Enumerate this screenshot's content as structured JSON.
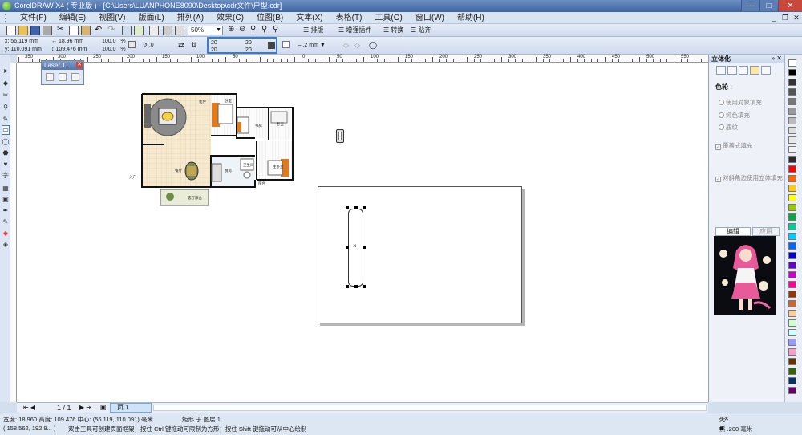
{
  "app": {
    "title": "CorelDRAW X4 ( 专业版 ) - [C:\\Users\\LUANPHONE8090\\Desktop\\cdr文件\\户型.cdr]"
  },
  "menu": [
    "文件(F)",
    "编辑(E)",
    "视图(V)",
    "版面(L)",
    "排列(A)",
    "效果(C)",
    "位图(B)",
    "文本(X)",
    "表格(T)",
    "工具(O)",
    "窗口(W)",
    "帮助(H)"
  ],
  "toolbar": {
    "zoom": "50%",
    "plugins": [
      "排版",
      "增强插件",
      "转换",
      "贴齐"
    ]
  },
  "properties": {
    "x": "56.119 mm",
    "y": "110.091 mm",
    "width": "18.96 mm",
    "height": "109.476 mm",
    "scale_x": "100.0",
    "scale_y": "100.0",
    "scale_unit": "%",
    "rotation": ".0",
    "corner_tl": "20",
    "corner_bl": "20",
    "corner_tr": "20",
    "corner_br": "20",
    "outline_width": ".2 mm"
  },
  "ruler": {
    "unit": "毫米",
    "top_labels": [
      "350",
      "300",
      "250",
      "200",
      "150",
      "100",
      "50",
      "0",
      "50",
      "100",
      "150",
      "200",
      "250",
      "300",
      "350",
      "400",
      "450",
      "500",
      "550"
    ]
  },
  "laser_toolbar": {
    "title": "Laser T..."
  },
  "floorplan": {
    "rooms": [
      "客厅",
      "卧室",
      "书房",
      "卧室",
      "主卧室",
      "餐厅",
      "厨房",
      "卫生间",
      "阳台",
      "客厅阳台"
    ],
    "entrance": "入户"
  },
  "docker": {
    "title": "立体化",
    "section": "色轮 :",
    "options": [
      "使用对象填充",
      "纯色填充",
      "底纹"
    ],
    "checkbox_overlay": "覆盖式填充",
    "checkbox_bevel": "对斜角边使用立体填充",
    "edit_button": "编辑",
    "apply_button": "应用"
  },
  "page_nav": {
    "counter": "1 / 1",
    "page_tab": "页 1"
  },
  "status": {
    "dimensions": "宽度: 18.960  高度: 109.476  中心: (56.119, 110.091)  毫米",
    "object": "矩形 于 图层 1",
    "cursor": "( 158.562, 192.9... )",
    "hint": "双击工具可创建页面框架；按住 Ctrl 键拖动可限制为方形；按住 Shift 键拖动可从中心绘制",
    "fill": "无",
    "outline": "黑 .200 毫米"
  },
  "colors": {
    "accent": "#3a7ad1",
    "selection": "#4a8fd6"
  }
}
